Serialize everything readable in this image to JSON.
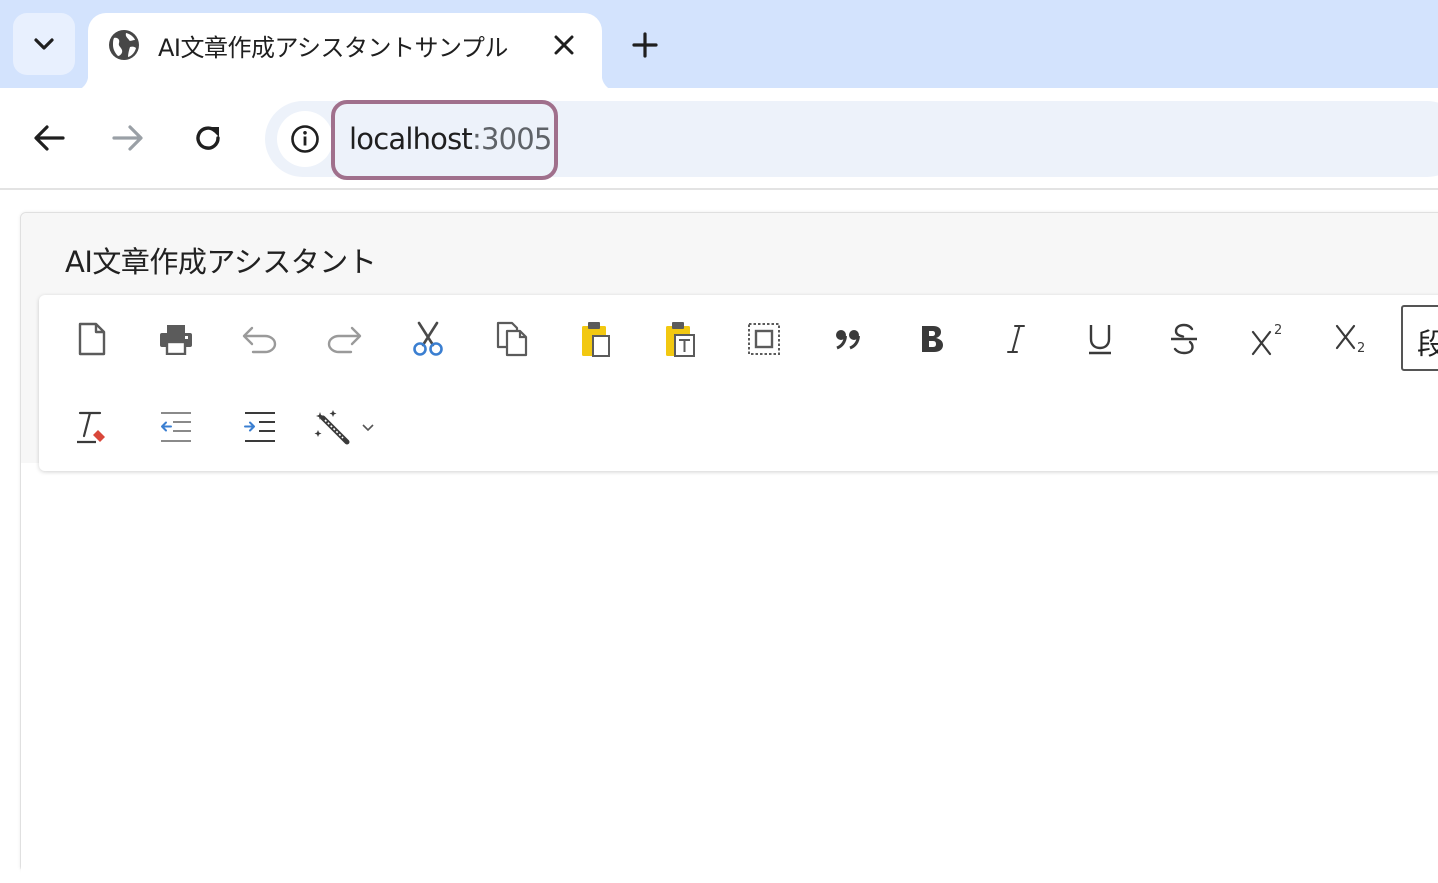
{
  "browser": {
    "tab_title": "AI文章作成アシスタントサンプル",
    "url_host": "localhost",
    "url_port": ":3005"
  },
  "page": {
    "title": "AI文章作成アシスタント",
    "format_dropdown_label": "段"
  },
  "toolbar": {
    "row1": [
      "new-document",
      "print",
      "undo",
      "redo",
      "cut",
      "copy",
      "paste",
      "paste-as-text",
      "select-all",
      "blockquote",
      "bold",
      "italic",
      "underline",
      "strikethrough",
      "superscript",
      "subscript"
    ],
    "row2": [
      "clear-format",
      "outdent",
      "indent",
      "ai-assistant"
    ]
  },
  "colors": {
    "tabstrip": "#d3e3fd",
    "omnibox": "#edf2fa",
    "url_highlight": "#a0708c",
    "cut_blue": "#3b7fd1",
    "paste_yellow": "#f2c811",
    "eraser_red": "#d9473a"
  }
}
